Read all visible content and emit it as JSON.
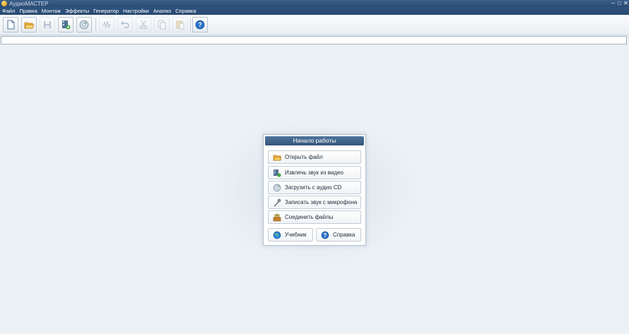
{
  "window": {
    "title": "АудиоМАСТЕР"
  },
  "menu": [
    "Файл",
    "Правка",
    "Монтаж",
    "Эффекты",
    "Генератор",
    "Настройки",
    "Анализ",
    "Справка"
  ],
  "dialog": {
    "title": "Начало работы",
    "buttons": {
      "open": "Открыть файл",
      "extract": "Извлечь звук из видео",
      "cd": "Загрузить с аудио CD",
      "mic": "Записать звук с микрофона",
      "join": "Соединить файлы",
      "tutorial": "Учебник",
      "help": "Справка"
    }
  },
  "colors": {
    "title_bar": "#2e5480",
    "dialog_header": "#4a6e95",
    "help_icon": "#2a72c8"
  }
}
